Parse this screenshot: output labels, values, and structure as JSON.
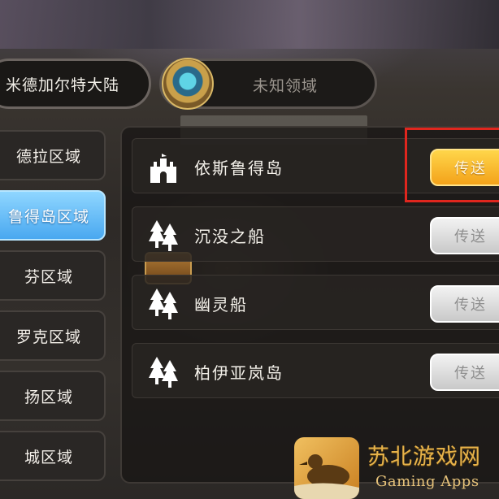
{
  "header": {
    "current_region": "米德加尔特大陆",
    "other_region": "未知领域"
  },
  "sidebar": {
    "items": [
      {
        "label": "德拉区域",
        "active": false
      },
      {
        "label": "鲁得岛区域",
        "active": true
      },
      {
        "label": "芬区域",
        "active": false
      },
      {
        "label": "罗克区域",
        "active": false
      },
      {
        "label": "扬区域",
        "active": false
      },
      {
        "label": "城区域",
        "active": false
      }
    ]
  },
  "locations": [
    {
      "name": "依斯鲁得岛",
      "icon": "castle-icon",
      "button": "传送",
      "button_state": "active"
    },
    {
      "name": "沉没之船",
      "icon": "pine-trees-icon",
      "button": "传送",
      "button_state": "disabled"
    },
    {
      "name": "幽灵船",
      "icon": "pine-trees-icon",
      "button": "传送",
      "button_state": "disabled"
    },
    {
      "name": "柏伊亚岚岛",
      "icon": "pine-trees-icon",
      "button": "传送",
      "button_state": "disabled"
    }
  ],
  "watermark": {
    "title": "苏北游戏网",
    "subtitle": "Gaming Apps"
  },
  "colors": {
    "active_tab": "#49a8f0",
    "teleport_active": "#f3a21a",
    "teleport_disabled": "#c9c9c9",
    "highlight_box": "#e0261e"
  }
}
